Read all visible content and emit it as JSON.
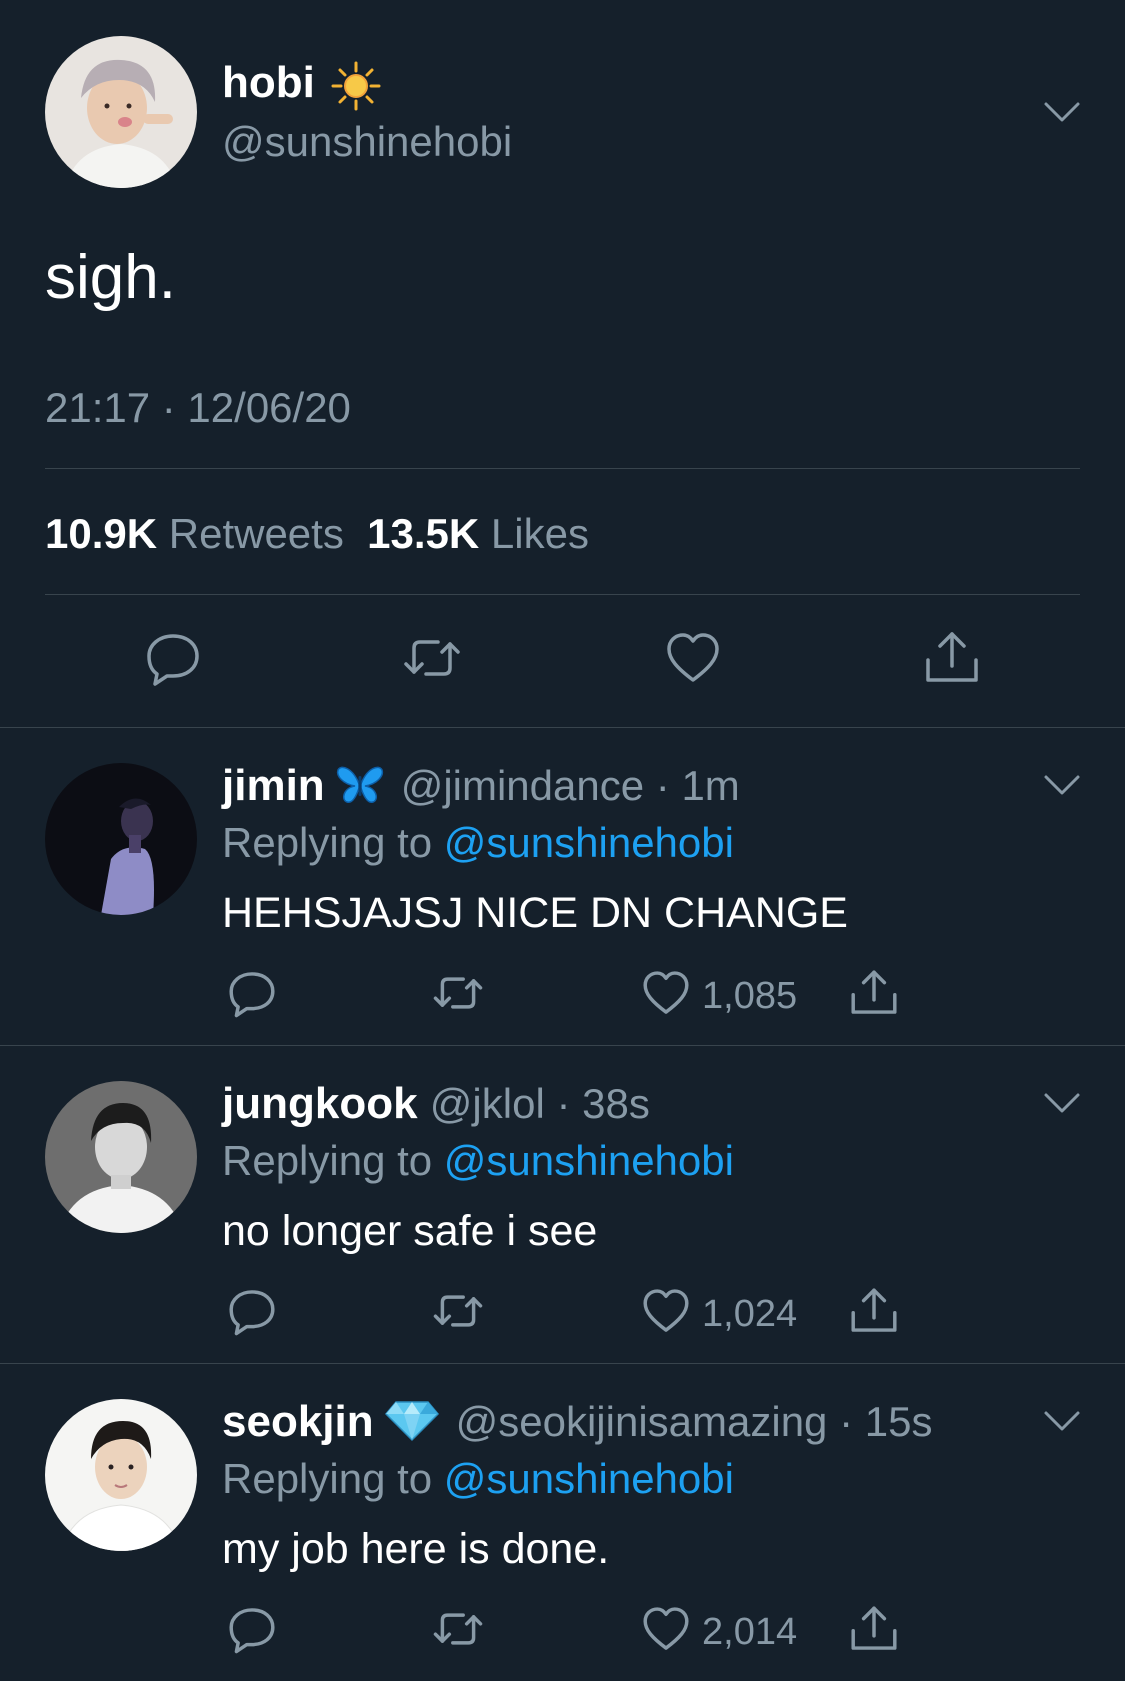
{
  "main_tweet": {
    "display_name": "hobi",
    "name_emoji": "sun",
    "handle": "@sunshinehobi",
    "text": "sigh.",
    "timestamp": "21:17 · 12/06/20",
    "retweets_count": "10.9K",
    "retweets_label": "Retweets",
    "likes_count": "13.5K",
    "likes_label": "Likes",
    "actions": [
      "reply-icon",
      "retweet-icon",
      "like-icon",
      "share-icon"
    ]
  },
  "replies": [
    {
      "display_name": "jimin",
      "name_emoji": "butterfly",
      "handle": "@jimindance",
      "time": "1m",
      "replying_label": "Replying to",
      "replying_to": "@sunshinehobi",
      "text": "HEHSJAJSJ NICE DN CHANGE",
      "likes": "1,085"
    },
    {
      "display_name": "jungkook",
      "name_emoji": "",
      "handle": "@jklol",
      "time": "38s",
      "replying_label": "Replying to",
      "replying_to": "@sunshinehobi",
      "text": "no longer safe i see",
      "likes": "1,024"
    },
    {
      "display_name": "seokjin",
      "name_emoji": "diamond",
      "handle": "@seokijinisamazing",
      "time": "15s",
      "replying_label": "Replying to",
      "replying_to": "@sunshinehobi",
      "text": "my job here is done.",
      "likes": "2,014"
    }
  ],
  "colors": {
    "background": "#15202b",
    "secondary_text": "#8899a6",
    "accent": "#1da1f2",
    "divider": "#38444d"
  }
}
